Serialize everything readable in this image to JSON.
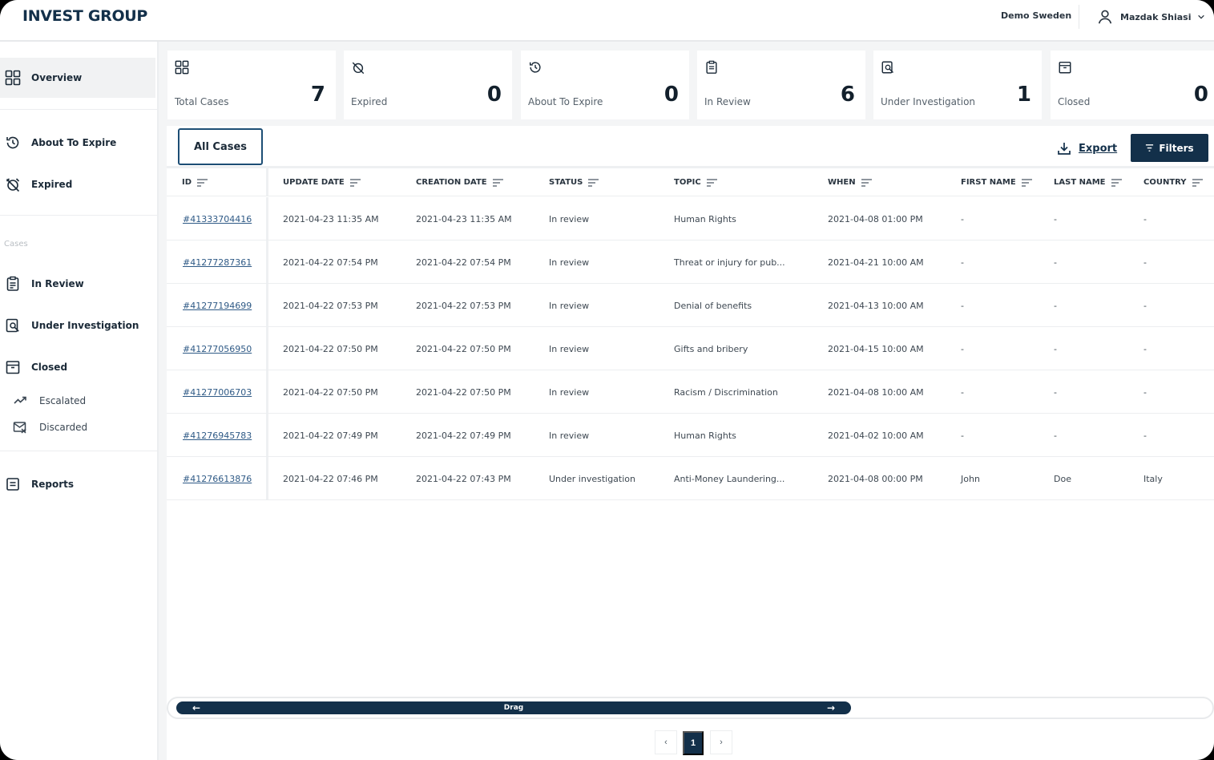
{
  "header": {
    "brand": "INVEST GROUP",
    "organization": "Demo Sweden",
    "user_name": "Mazdak Shiasi"
  },
  "sidebar": {
    "overview": "Overview",
    "about_to_expire": "About To Expire",
    "expired": "Expired",
    "cases_section": "Cases",
    "in_review": "In Review",
    "under_investigation": "Under Investigation",
    "closed": "Closed",
    "escalated": "Escalated",
    "discarded": "Discarded",
    "reports": "Reports"
  },
  "stats": [
    {
      "label": "Total Cases",
      "value": "7"
    },
    {
      "label": "Expired",
      "value": "0"
    },
    {
      "label": "About To Expire",
      "value": "0"
    },
    {
      "label": "In Review",
      "value": "6"
    },
    {
      "label": "Under Investigation",
      "value": "1"
    },
    {
      "label": "Closed",
      "value": "0"
    }
  ],
  "toolbar": {
    "tab_all_cases": "All Cases",
    "export": "Export",
    "filters": "Filters"
  },
  "table": {
    "columns": [
      "ID",
      "UPDATE DATE",
      "CREATION DATE",
      "STATUS",
      "TOPIC",
      "WHEN",
      "FIRST NAME",
      "LAST NAME",
      "COUNTRY"
    ],
    "rows": [
      [
        "#41333704416",
        "2021-04-23 11:35 AM",
        "2021-04-23 11:35 AM",
        "In review",
        "Human Rights",
        "2021-04-08 01:00 PM",
        "-",
        "-",
        "-"
      ],
      [
        "#41277287361",
        "2021-04-22 07:54 PM",
        "2021-04-22 07:54 PM",
        "In review",
        "Threat or injury for pub...",
        "2021-04-21 10:00 AM",
        "-",
        "-",
        "-"
      ],
      [
        "#41277194699",
        "2021-04-22 07:53 PM",
        "2021-04-22 07:53 PM",
        "In review",
        "Denial of benefits",
        "2021-04-13 10:00 AM",
        "-",
        "-",
        "-"
      ],
      [
        "#41277056950",
        "2021-04-22 07:50 PM",
        "2021-04-22 07:50 PM",
        "In review",
        "Gifts and bribery",
        "2021-04-15 10:00 AM",
        "-",
        "-",
        "-"
      ],
      [
        "#41277006703",
        "2021-04-22 07:50 PM",
        "2021-04-22 07:50 PM",
        "In review",
        "Racism / Discrimination",
        "2021-04-08 10:00 AM",
        "-",
        "-",
        "-"
      ],
      [
        "#41276945783",
        "2021-04-22 07:49 PM",
        "2021-04-22 07:49 PM",
        "In review",
        "Human Rights",
        "2021-04-02 10:00 AM",
        "-",
        "-",
        "-"
      ],
      [
        "#41276613876",
        "2021-04-22 07:46 PM",
        "2021-04-22 07:43 PM",
        "Under investigation",
        "Anti-Money Laundering...",
        "2021-04-08 00:00 PM",
        "John",
        "Doe",
        "Italy"
      ]
    ]
  },
  "scrollbar": {
    "label": "Drag",
    "left_arrow": "←",
    "right_arrow": "→"
  },
  "pagination": {
    "prev": "‹",
    "current": "1",
    "next": "›"
  },
  "colors": {
    "primary": "#13304a",
    "link": "#2f5a86",
    "background": "#f4f5f6"
  }
}
